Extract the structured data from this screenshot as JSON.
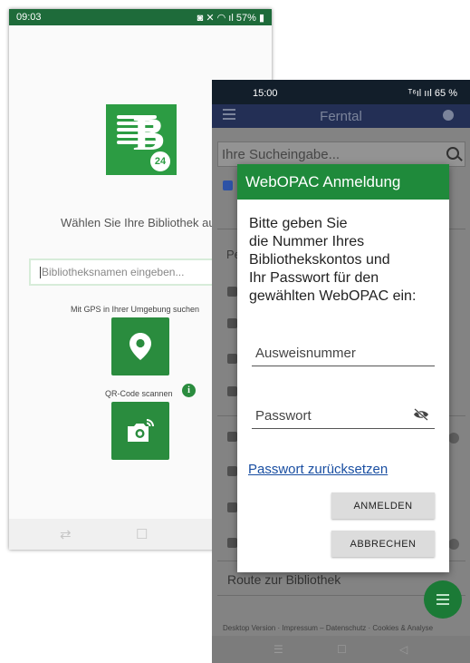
{
  "back_phone": {
    "status": {
      "time": "09:03",
      "battery": "57%"
    },
    "logo": {
      "letter": "B",
      "badge": "24"
    },
    "choose_text": "Wählen Sie Ihre Bibliothek au",
    "library_input_placeholder": "Bibliotheksnamen eingeben...",
    "gps_label": "Mit GPS in Ihrer Umgebung suchen",
    "qr_label": "QR-Code scannen",
    "info_glyph": "i",
    "nav": {
      "recent": "⇄",
      "home": "☐"
    }
  },
  "front_phone": {
    "status": {
      "time": "15:00",
      "right": "ᵀ⁶ıl ııl 65 %"
    },
    "app_title": "Ferntal",
    "search_placeholder": "Ihre Sucheingabe...",
    "row_labels": [
      "Pe"
    ],
    "route_text": "Route zur Bibliothek",
    "footer_text": "Desktop Version · Impressum – Datenschutz · Cookies & Analyse",
    "nav": {
      "recent": "☰",
      "home": "☐",
      "back": "◁"
    }
  },
  "dialog": {
    "title": "WebOPAC Anmeldung",
    "message_lines": [
      "Bitte geben Sie",
      "die Nummer Ihres",
      "Bibliothekskontos und",
      "Ihr Passwort für den",
      "gewählten WebOPAC ein:"
    ],
    "id_placeholder": "Ausweisnummer",
    "password_placeholder": "Passwort",
    "reset_link": "Passwort zurücksetzen",
    "login_button": "ANMELDEN",
    "cancel_button": "ABBRECHEN"
  },
  "colors": {
    "brand_green": "#2c9c43",
    "dialog_green": "#1f8a3b",
    "link_blue": "#1a4fa2"
  }
}
